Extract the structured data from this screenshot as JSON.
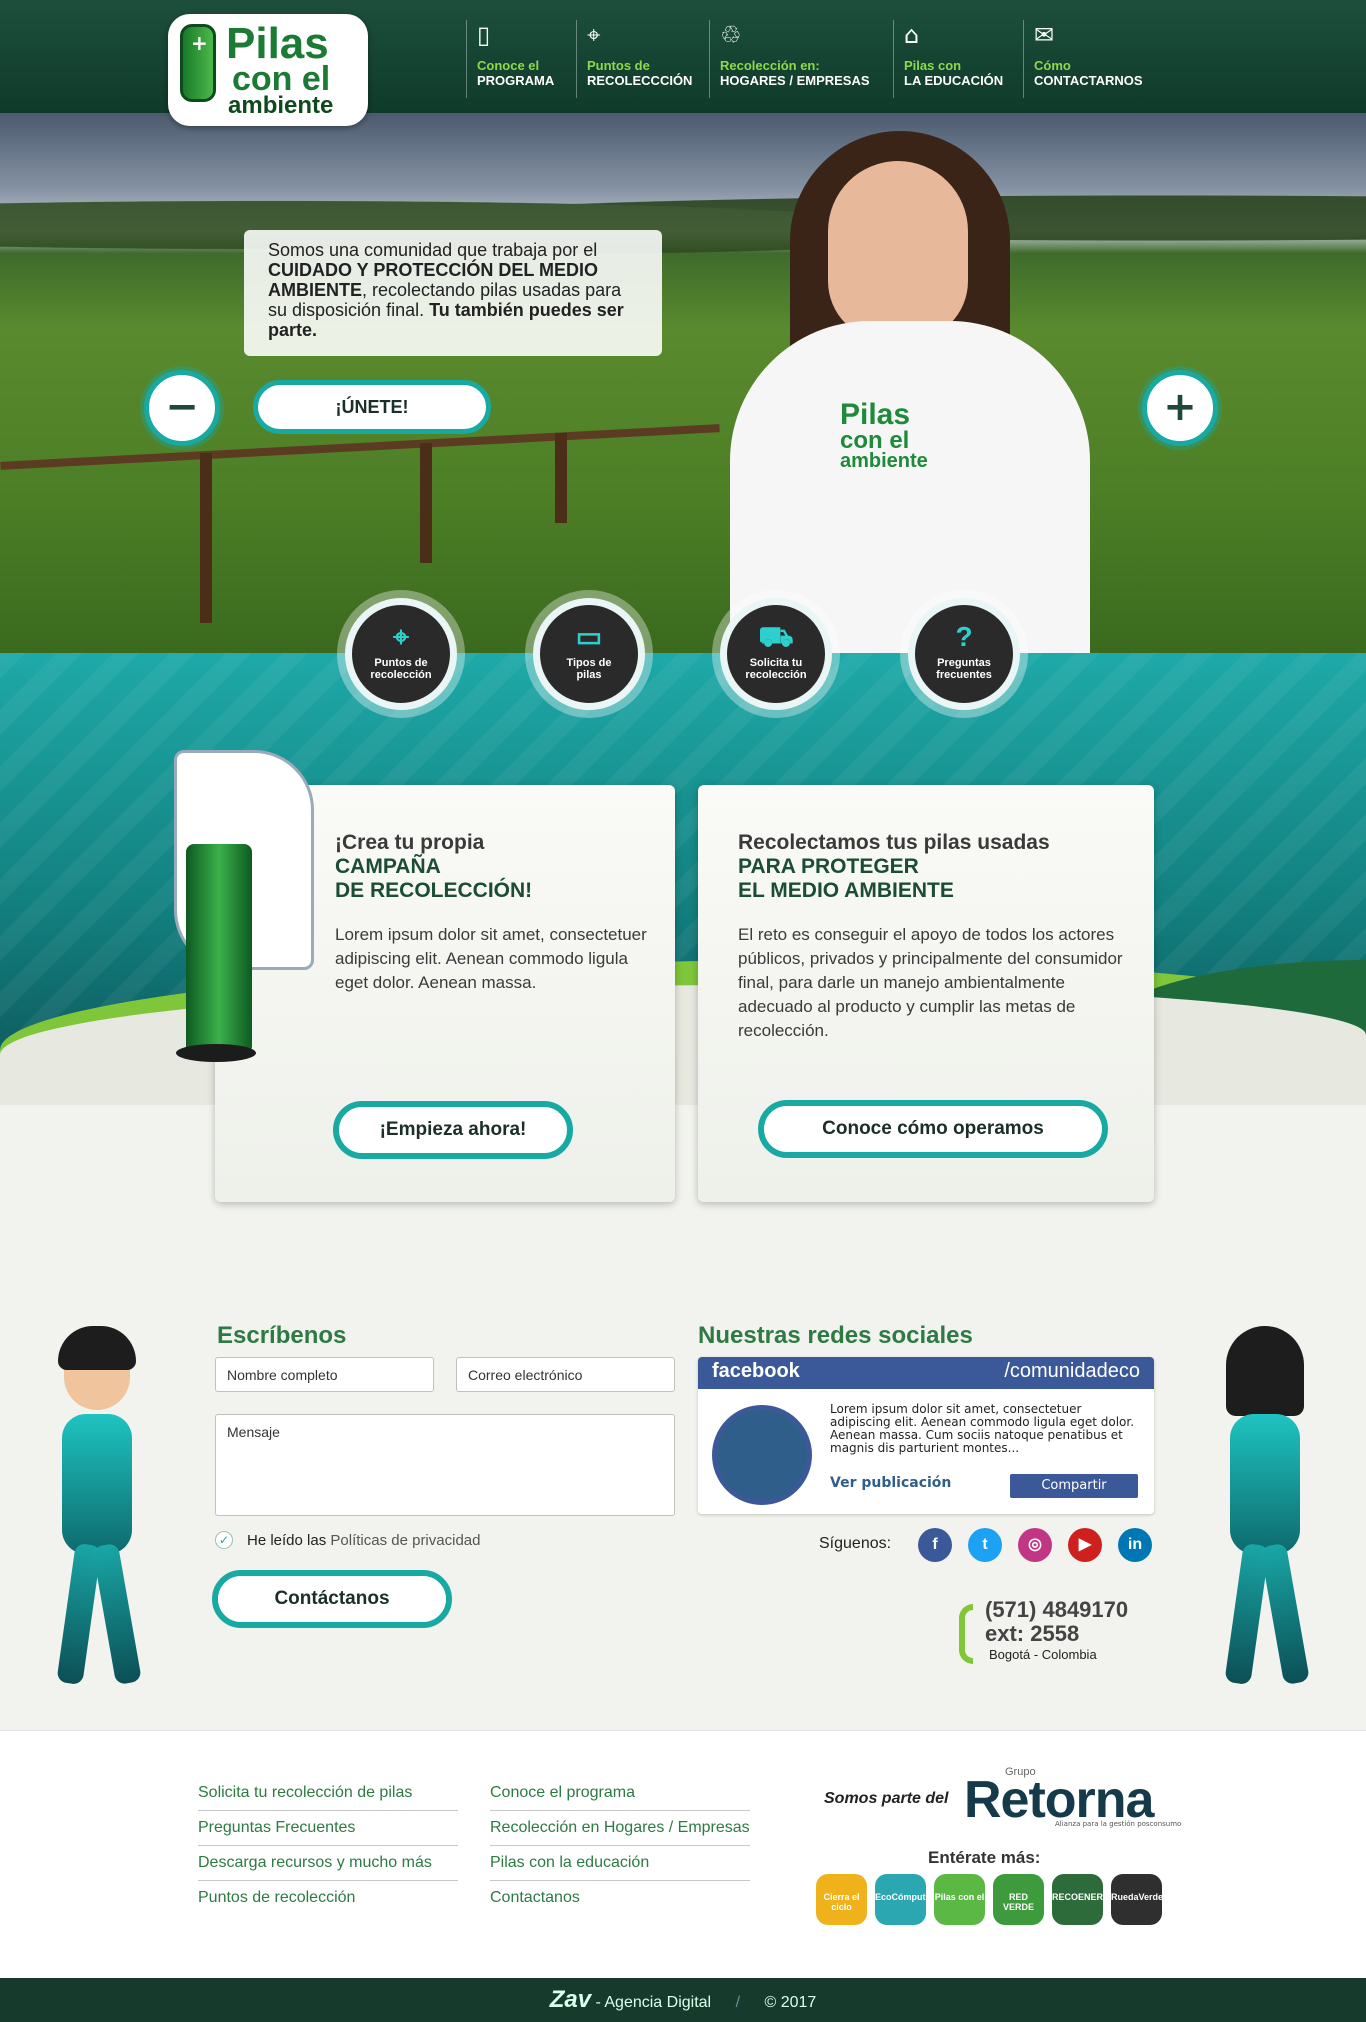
{
  "brand": {
    "logo_line1": "Pilas",
    "logo_line2": "con el",
    "logo_line3": "ambiente",
    "primary": "#1d4f3c",
    "accent": "#18a9a3",
    "green": "#2d7a43",
    "lime": "#8ed84b"
  },
  "nav": [
    {
      "line1": "Conoce el",
      "line2": "PROGRAMA",
      "icon": "book-icon"
    },
    {
      "line1": "Puntos de",
      "line2": "RECOLECCCIÓN",
      "icon": "map-pin-icon"
    },
    {
      "line1": "Recolección en:",
      "line2": "HOGARES / EMPRESAS",
      "icon": "person-recycle-icon"
    },
    {
      "line1": "Pilas con",
      "line2": "LA EDUCACIÓN",
      "icon": "graduation-cap-icon"
    },
    {
      "line1": "Cómo",
      "line2": "CONTACTARNOS",
      "icon": "envelope-icon"
    }
  ],
  "hero": {
    "intro_1": "Somos una comunidad que trabaja por el ",
    "intro_bold1": "CUIDADO Y PROTECCIÓN DEL MEDIO AMBIENTE",
    "intro_2": ", recolectando pilas usadas para su disposición final. ",
    "intro_bold2": "Tu también puedes ser parte.",
    "join_label": "¡ÚNETE!",
    "prev": "−",
    "next": "+",
    "shirt_logo_1": "Pilas",
    "shirt_logo_2": "con el",
    "shirt_logo_3": "ambiente"
  },
  "circles": [
    {
      "l1": "Puntos de",
      "l2": "recolección",
      "icon": "map-pin-icon"
    },
    {
      "l1": "Tipos de",
      "l2": "pilas",
      "icon": "battery-icon"
    },
    {
      "l1": "Solicita tu",
      "l2": "recolección",
      "icon": "truck-icon"
    },
    {
      "l1": "Preguntas",
      "l2": "frecuentes",
      "icon": "question-icon"
    }
  ],
  "cards": [
    {
      "k1": "¡Crea tu propia",
      "k2a": "CAMPAÑA",
      "k2b": "DE RECOLECCIÓN!",
      "text": "Lorem ipsum dolor sit amet, consectetuer adipiscing elit. Aenean commodo ligula eget dolor. Aenean massa.",
      "button": "¡Empieza ahora!"
    },
    {
      "k1": "Recolectamos tus pilas usadas",
      "k2a": "PARA PROTEGER",
      "k2b": "EL MEDIO AMBIENTE",
      "text": "El reto es conseguir el apoyo de todos los actores públicos, privados y principalmente del consumidor final, para darle un manejo ambientalmente adecuado al producto y cumplir las metas de recolección.",
      "button": "Conoce cómo operamos"
    }
  ],
  "contact": {
    "title": "Escríbenos",
    "name_placeholder": "Nombre completo",
    "email_placeholder": "Correo electrónico",
    "message_placeholder": "Mensaje",
    "privacy_prefix": "He leído las ",
    "privacy_link": "Políticas de privacidad",
    "privacy_checked": true,
    "submit": "Contáctanos"
  },
  "social": {
    "title": "Nuestras redes sociales",
    "fb_brand": "facebook",
    "fb_handle": "/comunidadeco",
    "fb_text": "Lorem ipsum dolor sit amet, consectetuer adipiscing elit. Aenean commodo ligula eget dolor. Aenean massa. Cum sociis natoque penatibus et magnis dis parturient montes...",
    "fb_link": "Ver publicación",
    "fb_share": "Compartir",
    "follow": "Síguenos:",
    "icons": [
      {
        "name": "facebook-icon",
        "glyph": "f",
        "color": "#3b5998"
      },
      {
        "name": "twitter-icon",
        "glyph": "t",
        "color": "#1da1f2"
      },
      {
        "name": "instagram-icon",
        "glyph": "◎",
        "color": "#c13584"
      },
      {
        "name": "youtube-icon",
        "glyph": "▶",
        "color": "#cd201f"
      },
      {
        "name": "linkedin-icon",
        "glyph": "in",
        "color": "#0077b5"
      }
    ],
    "phone": "(571) 4849170",
    "ext": "ext: 2558",
    "city": "Bogotá - Colombia"
  },
  "footer": {
    "col1": [
      "Solicita tu recolección de pilas",
      "Preguntas Frecuentes",
      "Descarga recursos y mucho más",
      "Puntos de recolección"
    ],
    "col2": [
      "Conoce el programa",
      "Recolección en Hogares / Empresas",
      "Pilas con la educación",
      "Contactanos"
    ],
    "partner_prefix": "Somos parte del",
    "partner_group": "Grupo",
    "partner_name": "Retorna",
    "partner_tagline": "Alianza para la gestión posconsumo",
    "more": "Entérate más:",
    "badges": [
      {
        "label": "Cierra el ciclo",
        "color": "#f0b21b"
      },
      {
        "label": "EcoCómputo",
        "color": "#2aa7b0"
      },
      {
        "label": "Pilas con el",
        "color": "#5cb845"
      },
      {
        "label": "RED VERDE",
        "color": "#3d9a3d"
      },
      {
        "label": "RECOENERGY",
        "color": "#2d6b3a"
      },
      {
        "label": "RuedaVerde",
        "color": "#2f2f2f"
      }
    ]
  },
  "bottom": {
    "agency": "Zav",
    "agency_label": " - Agencia Digital",
    "copyright": "© 2017"
  }
}
